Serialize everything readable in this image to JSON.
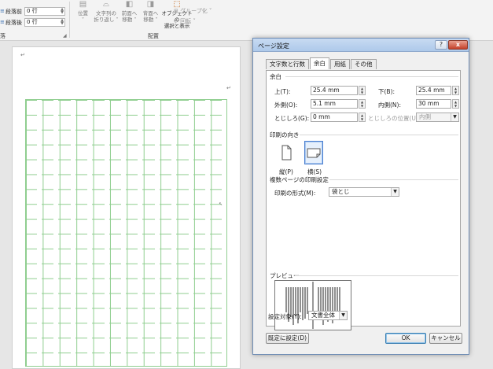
{
  "ribbon": {
    "spacing_before_label": "段落前",
    "spacing_before_value": "0 行",
    "spacing_after_label": "段落後",
    "spacing_after_value": "0 行",
    "paragraph_group_label": "落",
    "tools": [
      {
        "line1": "位置",
        "line2": "˅"
      },
      {
        "line1": "文字列の",
        "line2": "折り返し ˅"
      },
      {
        "line1": "前面へ",
        "line2": "移動 ˅"
      },
      {
        "line1": "背面へ",
        "line2": "移動 ˅"
      },
      {
        "line1": "オブジェクトの",
        "line2": "選択と表示"
      }
    ],
    "side_group": "グループ化 ˅",
    "side_rotate": "回転 ˅",
    "arrange_group_label": "配置"
  },
  "document": {
    "top_mark": "↵",
    "right_mark": "↵",
    "cursor_mark": "↖"
  },
  "dialog": {
    "title": "ページ設定",
    "help": "?",
    "close": "x",
    "tabs": [
      {
        "label": "文字数と行数",
        "active": false
      },
      {
        "label": "余白",
        "active": true
      },
      {
        "label": "用紙",
        "active": false
      },
      {
        "label": "その他",
        "active": false
      }
    ],
    "margins": {
      "section_label": "余白",
      "top_label": "上(T):",
      "top_value": "25.4 mm",
      "bottom_label": "下(B):",
      "bottom_value": "25.4 mm",
      "outside_label": "外側(O):",
      "outside_value": "5.1 mm",
      "inside_label": "内側(N):",
      "inside_value": "30 mm",
      "gutter_label": "とじしろ(G):",
      "gutter_value": "0 mm",
      "gutter_pos_label": "とじしろの位置(U):",
      "gutter_pos_value": "内側"
    },
    "orientation": {
      "section_label": "印刷の向き",
      "portrait_label": "縦(P)",
      "landscape_label": "横(S)",
      "selected": "landscape"
    },
    "multiple_pages": {
      "section_label": "複数ページの印刷設定",
      "format_label": "印刷の形式(M):",
      "format_value": "袋とじ"
    },
    "preview": {
      "section_label": "プレビュー"
    },
    "apply_to": {
      "label": "設定対象(Y):",
      "value": "文書全体"
    },
    "buttons": {
      "set_default": "既定に設定(D)",
      "ok": "OK",
      "cancel": "キャンセル"
    },
    "colors": {
      "title_bar": "#aec9ea",
      "close_button": "#c4412a",
      "selection": "#4a7fd0"
    }
  }
}
